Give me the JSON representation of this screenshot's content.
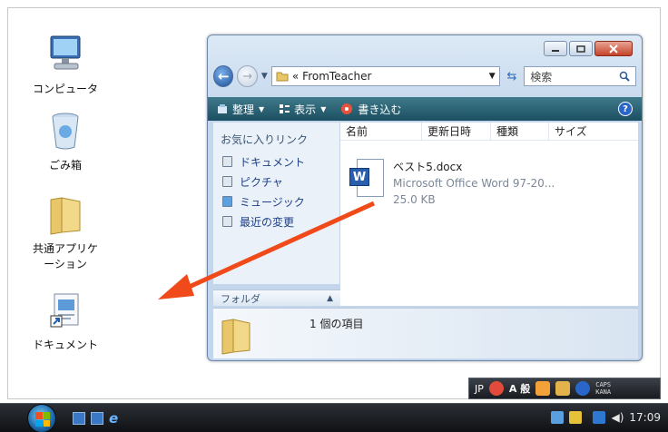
{
  "desktop": {
    "icons": [
      {
        "label": "コンピュータ",
        "icon": "computer-icon"
      },
      {
        "label": "ごみ箱",
        "icon": "recycle-bin-icon"
      },
      {
        "label_line1": "共通アプリケ",
        "label_line2": "ーション",
        "icon": "folder-icon"
      },
      {
        "label": "ドキュメント",
        "icon": "documents-shortcut-icon"
      }
    ]
  },
  "explorer": {
    "address": {
      "prefix": "«",
      "path": "FromTeacher"
    },
    "search_placeholder": "検索",
    "toolbar": {
      "organize": "整理",
      "views": "表示",
      "burn": "書き込む",
      "help": "?"
    },
    "nav_header": "お気に入りリンク",
    "nav_items": [
      "ドキュメント",
      "ピクチャ",
      "ミュージック",
      "最近の変更"
    ],
    "folders_label": "フォルダ",
    "columns": [
      "名前",
      "更新日時",
      "種類",
      "サイズ"
    ],
    "file": {
      "name": "ベスト5.docx",
      "type": "Microsoft Office Word 97-20...",
      "size": "25.0 KB"
    },
    "details_text": "1 個の項目"
  },
  "langbar": {
    "lang": "JP",
    "ime_mode": "A 般",
    "caps": "CAPS",
    "kana": "KANA"
  },
  "taskbar": {
    "clock": "17:09"
  },
  "annotation": {
    "arrow_color": "#f04a1a"
  }
}
